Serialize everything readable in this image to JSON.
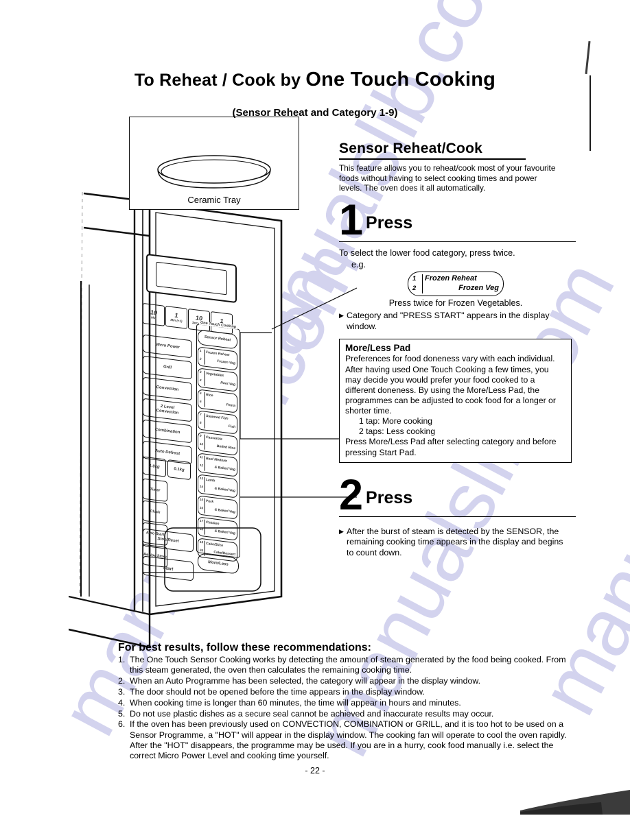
{
  "page": {
    "title_part1": "To Reheat / Cook by ",
    "title_part2": "One Touch Cooking",
    "subtitle": "(Sensor Reheat and Category 1-9)",
    "page_number": "- 22 -",
    "watermark": "manualslib.com",
    "watermark_color": "#d3d3ee"
  },
  "tray_figure": {
    "caption": "Ceramic Tray"
  },
  "section": {
    "heading": "Sensor Reheat/Cook",
    "intro": "This feature allows you to reheat/cook most of your favourite foods without having to select cooking times and power levels. The oven does it all automatically."
  },
  "step1": {
    "number": "1",
    "press_label": "Press",
    "instruction": "To select the lower food category, press twice.",
    "eg_label": "e.g.",
    "chip": {
      "n1": "1",
      "n2": "2",
      "l1": "Frozen Reheat",
      "l2": "Frozen Veg"
    },
    "chip_caption": "Press twice for Frozen Vegetables.",
    "bullet": "Category and \"PRESS START\" appears in the display window."
  },
  "more_less": {
    "title": "More/Less Pad",
    "body1": "Preferences for food doneness vary with each individual. After having used One Touch Cooking a few times, you may decide you would prefer your food cooked to a different doneness. By using the More/Less Pad, the programmes can be adjusted to cook food for a longer or shorter time.",
    "tap1": "1 tap: More cooking",
    "tap2": "2 taps: Less cooking",
    "body2": "Press More/Less Pad after selecting category and before pressing Start Pad."
  },
  "step2": {
    "number": "2",
    "press_label": "Press",
    "bullet": "After the burst of steam is detected by the SENSOR, the remaining cooking time appears in the display and begins to count down."
  },
  "recommendations": {
    "heading": "For best results, follow these recommendations:",
    "items": [
      {
        "idx": "1.",
        "text": "The One Touch Sensor Cooking works by detecting the amount of steam generated by the food being cooked. From this steam generated, the oven then calculates the remaining cooking time."
      },
      {
        "idx": "2.",
        "text": "When an Auto Programme has been selected, the category will appear in the display window."
      },
      {
        "idx": "3.",
        "text": "The door should not be opened before the time appears in the display window."
      },
      {
        "idx": "4.",
        "text": "When cooking time is longer than 60 minutes, the time will appear in hours and minutes."
      },
      {
        "idx": "5.",
        "text": "Do not use plastic dishes as a secure seal cannot be achieved and inaccurate results may occur."
      },
      {
        "idx": "6.",
        "text": "If the oven has been previously used on CONVECTION, COMBINATION or GRILL, and it is too hot to be used on a Sensor Programme, a \"HOT\" will appear in the display window. The cooking fan will operate to cool the oven rapidly. After the \"HOT\" disappears, the programme may be used. If you are in a hurry, cook food manually i.e. select the correct Micro Power Level and cooking time yourself."
      }
    ]
  },
  "control_panel": {
    "time_pads": [
      {
        "big": "10",
        "small": "Min"
      },
      {
        "big": "1",
        "small": "Min (+1)"
      },
      {
        "big": "10",
        "small": "Sec (Min)"
      },
      {
        "big": "1",
        "small": "Sec (Min)"
      }
    ],
    "left_pads": [
      {
        "line1": "Micro Power",
        "line2": ""
      },
      {
        "line1": "Grill",
        "line2": ""
      },
      {
        "line1": "Convection",
        "line2": ""
      },
      {
        "line1": "2 Level",
        "line2": "Convection"
      },
      {
        "line1": "Combination",
        "line2": ""
      },
      {
        "line1": "Auto Defrost",
        "line2": ""
      }
    ],
    "weight_pads": [
      "1.0kg",
      "0.1kg"
    ],
    "quad_pads": [
      "Timer",
      "Clock",
      "Auto Start",
      "Recipe Store"
    ],
    "stop_pad": "Stop/Reset",
    "start_pad": "Start",
    "one_touch_label": "One Touch Cooking",
    "one_touch_pads": [
      {
        "n1": "",
        "n2": "",
        "l1": "Sensor Reheat",
        "l2": ""
      },
      {
        "n1": "1",
        "n2": "2",
        "l1": "Frozen Reheat",
        "l2": "Frozen Veg"
      },
      {
        "n1": "3",
        "n2": "4",
        "l1": "Vegetables",
        "l2": "Root Veg"
      },
      {
        "n1": "5",
        "n2": "6",
        "l1": "Rice",
        "l2": "Pasta"
      },
      {
        "n1": "7",
        "n2": "8",
        "l1": "Steamed Fish",
        "l2": "Fish"
      },
      {
        "n1": "9",
        "n2": "10",
        "l1": "Casserole",
        "l2": "Boiled Rice"
      },
      {
        "n1": "11",
        "n2": "12",
        "l1": "Beef Medium",
        "l2": "& Baked Veg"
      },
      {
        "n1": "13",
        "n2": "14",
        "l1": "Lamb",
        "l2": "& Baked Veg"
      },
      {
        "n1": "15",
        "n2": "16",
        "l1": "Pork",
        "l2": "& Baked Veg"
      },
      {
        "n1": "17",
        "n2": "18",
        "l1": "Chicken",
        "l2": "& Baked Veg"
      },
      {
        "n1": "19",
        "n2": "20",
        "l1": "Cake/Slice",
        "l2": "Cake/Dessert"
      }
    ],
    "more_less_pad": "More/Less"
  }
}
